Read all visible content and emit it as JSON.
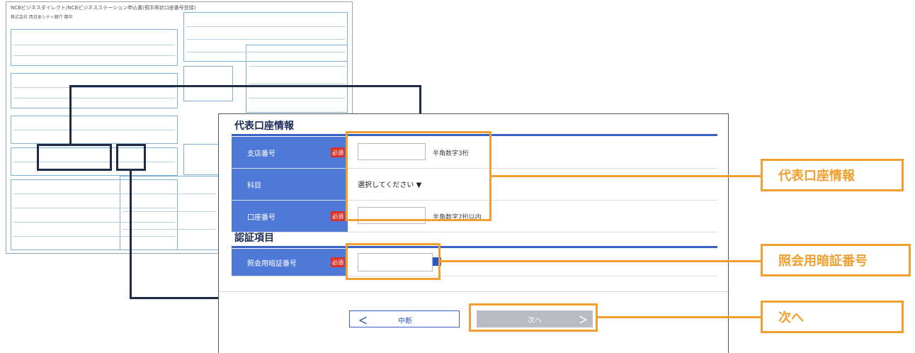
{
  "paper": {
    "title": "NCBビジネスダイレクト/NCBビジネスステーション申込書(預手照状口座番号登録)",
    "bank": "株式会社 西日本シティ銀行 御中"
  },
  "panel": {
    "account_section_title": "代表口座情報",
    "auth_section_title": "認証項目",
    "required_label": "必須",
    "fields": {
      "branch_label": "支店番号",
      "branch_hint": "半角数字3桁",
      "type_label": "科目",
      "type_select": "選択してください ▼",
      "account_label": "口座番号",
      "account_hint": "半角数字7桁以内",
      "pin_label": "照会用暗証番号"
    },
    "buttons": {
      "back_icon": "＜",
      "back_label": "中断",
      "next_label": "次へ",
      "next_icon": "＞"
    }
  },
  "callouts": {
    "account": "代表口座情報",
    "pin": "照会用暗証番号",
    "next": "次へ"
  },
  "colors": {
    "accent_blue": "#4f79d6",
    "required_red": "#d8342c",
    "callout_orange": "#f0a030",
    "connector_navy": "#1e2d45"
  },
  "icons": {
    "arrow_head": "arrow-down-icon",
    "arrow_up": "arrow-up-icon"
  }
}
